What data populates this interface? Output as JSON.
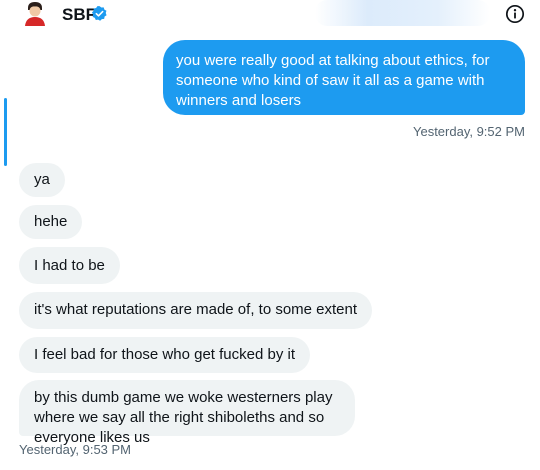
{
  "conversation": {
    "name": "SBF",
    "avatar_icon": "person-avatar-icon",
    "verified_icon": "verified-badge-icon",
    "info_icon": "info-icon"
  },
  "colors": {
    "accent": "#1d9bf0",
    "received_bubble": "#eff3f4",
    "text": "#0f1419",
    "muted": "#536471"
  },
  "messages": {
    "sent": [
      {
        "text": "you were really good at talking about ethics, for someone who kind of saw it all as a game with winners and losers"
      }
    ],
    "sent_timestamp": "Yesterday, 9:52 PM",
    "received": [
      {
        "text": "ya"
      },
      {
        "text": "hehe"
      },
      {
        "text": "I had to be"
      },
      {
        "text": "it's what reputations are made of, to some extent"
      },
      {
        "text": "I feel bad for those who get fucked by it"
      },
      {
        "text": "by this dumb game we woke westerners play where we say all the right shiboleths and so everyone likes us"
      }
    ],
    "received_timestamp": "Yesterday, 9:53 PM"
  }
}
